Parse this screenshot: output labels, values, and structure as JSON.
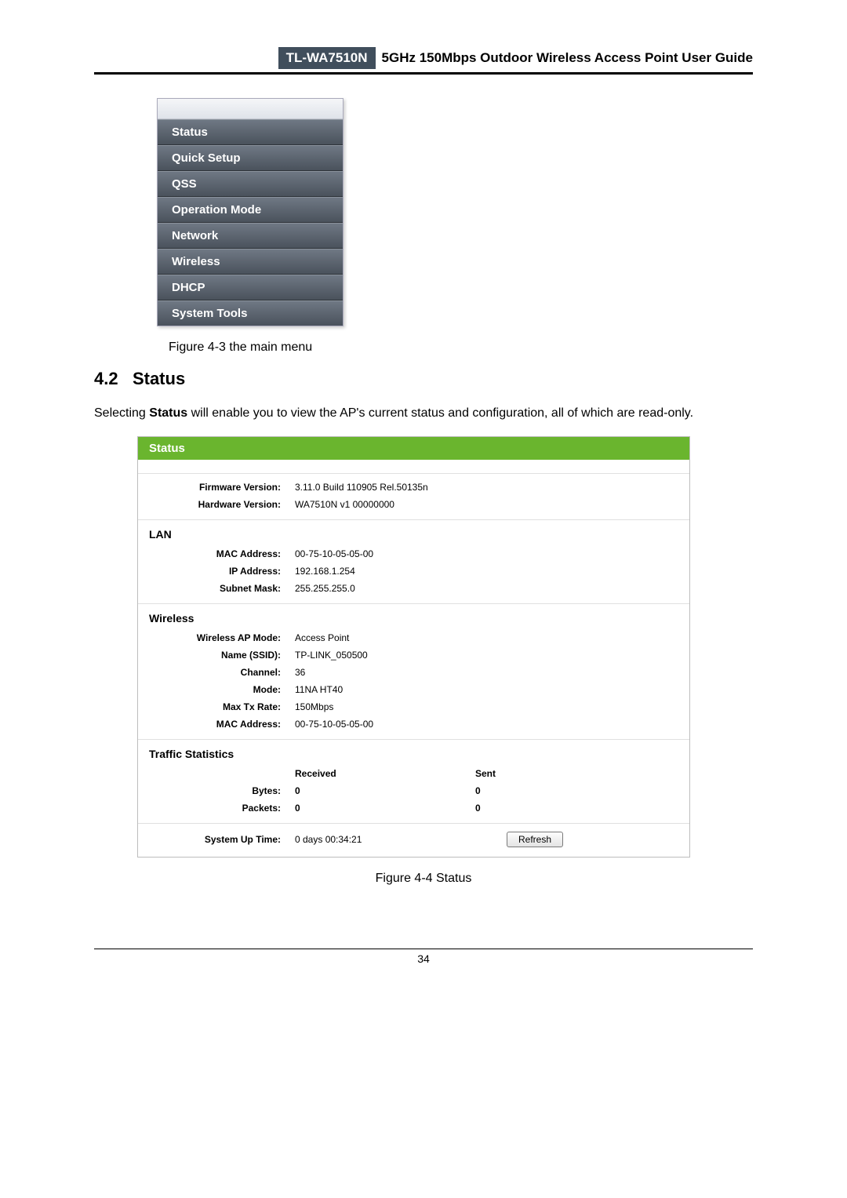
{
  "header": {
    "model": "TL-WA7510N",
    "title": "5GHz 150Mbps Outdoor Wireless Access Point User Guide"
  },
  "menu": {
    "items": [
      "Status",
      "Quick Setup",
      "QSS",
      "Operation Mode",
      "Network",
      "Wireless",
      "DHCP",
      "System Tools"
    ]
  },
  "caption_menu": "Figure 4-3 the main menu",
  "section": {
    "number": "4.2",
    "title": "Status"
  },
  "paragraph": {
    "pre": "Selecting ",
    "bold": "Status",
    "post": " will enable you to view the AP's current status and configuration, all of which are read-only."
  },
  "status": {
    "head": "Status",
    "firmware_label": "Firmware Version:",
    "firmware": "3.11.0 Build 110905 Rel.50135n",
    "hardware_label": "Hardware Version:",
    "hardware": "WA7510N v1 00000000",
    "lan_head": "LAN",
    "lan": {
      "mac_label": "MAC Address:",
      "mac": "00-75-10-05-05-00",
      "ip_label": "IP Address:",
      "ip": "192.168.1.254",
      "mask_label": "Subnet Mask:",
      "mask": "255.255.255.0"
    },
    "wireless_head": "Wireless",
    "wireless": {
      "apmode_label": "Wireless AP Mode:",
      "apmode": "Access Point",
      "ssid_label": "Name (SSID):",
      "ssid": "TP-LINK_050500",
      "channel_label": "Channel:",
      "channel": "36",
      "mode_label": "Mode:",
      "mode": "11NA HT40",
      "rate_label": "Max Tx Rate:",
      "rate": "150Mbps",
      "mac_label": "MAC Address:",
      "mac": "00-75-10-05-05-00"
    },
    "traffic_head": "Traffic Statistics",
    "traffic": {
      "col_recv": "Received",
      "col_sent": "Sent",
      "bytes_label": "Bytes:",
      "bytes_recv": "0",
      "bytes_sent": "0",
      "packets_label": "Packets:",
      "packets_recv": "0",
      "packets_sent": "0"
    },
    "uptime_label": "System Up Time:",
    "uptime": "0 days 00:34:21",
    "refresh": "Refresh"
  },
  "caption_status": "Figure 4-4 Status",
  "page_number": "34"
}
